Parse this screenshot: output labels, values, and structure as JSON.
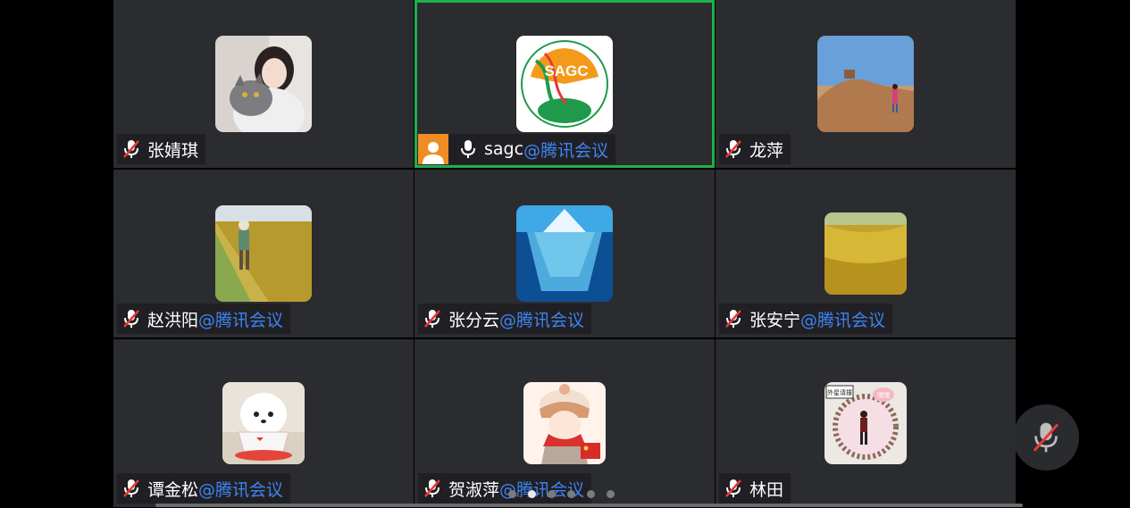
{
  "participants": [
    {
      "name": "张婧琪",
      "suffix": "",
      "avatar": "girl-with-cat-photo",
      "muted": true
    },
    {
      "name": "sagc",
      "suffix": "@腾讯会议",
      "avatar": "sagc-logo",
      "muted": false,
      "active_speaker": true,
      "host": true,
      "logo": {
        "top_text": "上海市农业生物基因中心",
        "center_text": "SAGC",
        "bottom_text": "SHANGHAI AGROBIOLOGICAL GENE CENTER"
      }
    },
    {
      "name": "龙萍",
      "suffix": "",
      "avatar": "desert-photo",
      "muted": true
    },
    {
      "name": "赵洪阳",
      "suffix": "@腾讯会议",
      "avatar": "rice-field-worker-photo",
      "muted": true
    },
    {
      "name": "张分云",
      "suffix": "@腾讯会议",
      "avatar": "iceberg-photo",
      "muted": true
    },
    {
      "name": "张安宁",
      "suffix": "@腾讯会议",
      "avatar": "golden-rice-photo",
      "muted": true
    },
    {
      "name": "谭金松",
      "suffix": "@腾讯会议",
      "avatar": "puppy-in-cup-photo",
      "muted": true
    },
    {
      "name": "贺淑萍",
      "suffix": "@腾讯会议",
      "avatar": "cartoon-girl-avatar",
      "muted": true
    },
    {
      "name": "林田",
      "suffix": "",
      "avatar": "person-in-circle-art",
      "muted": true,
      "art_labels": {
        "sign": "外星请撞",
        "bubble": "嘿嘿"
      }
    }
  ],
  "pagination": {
    "total_pages": 6,
    "current_page": 2
  },
  "colors": {
    "active_border": "#1fb04a",
    "suffix": "#3e83f2",
    "tile_bg": "#2b2c2f",
    "host_badge": "#f08c24"
  }
}
